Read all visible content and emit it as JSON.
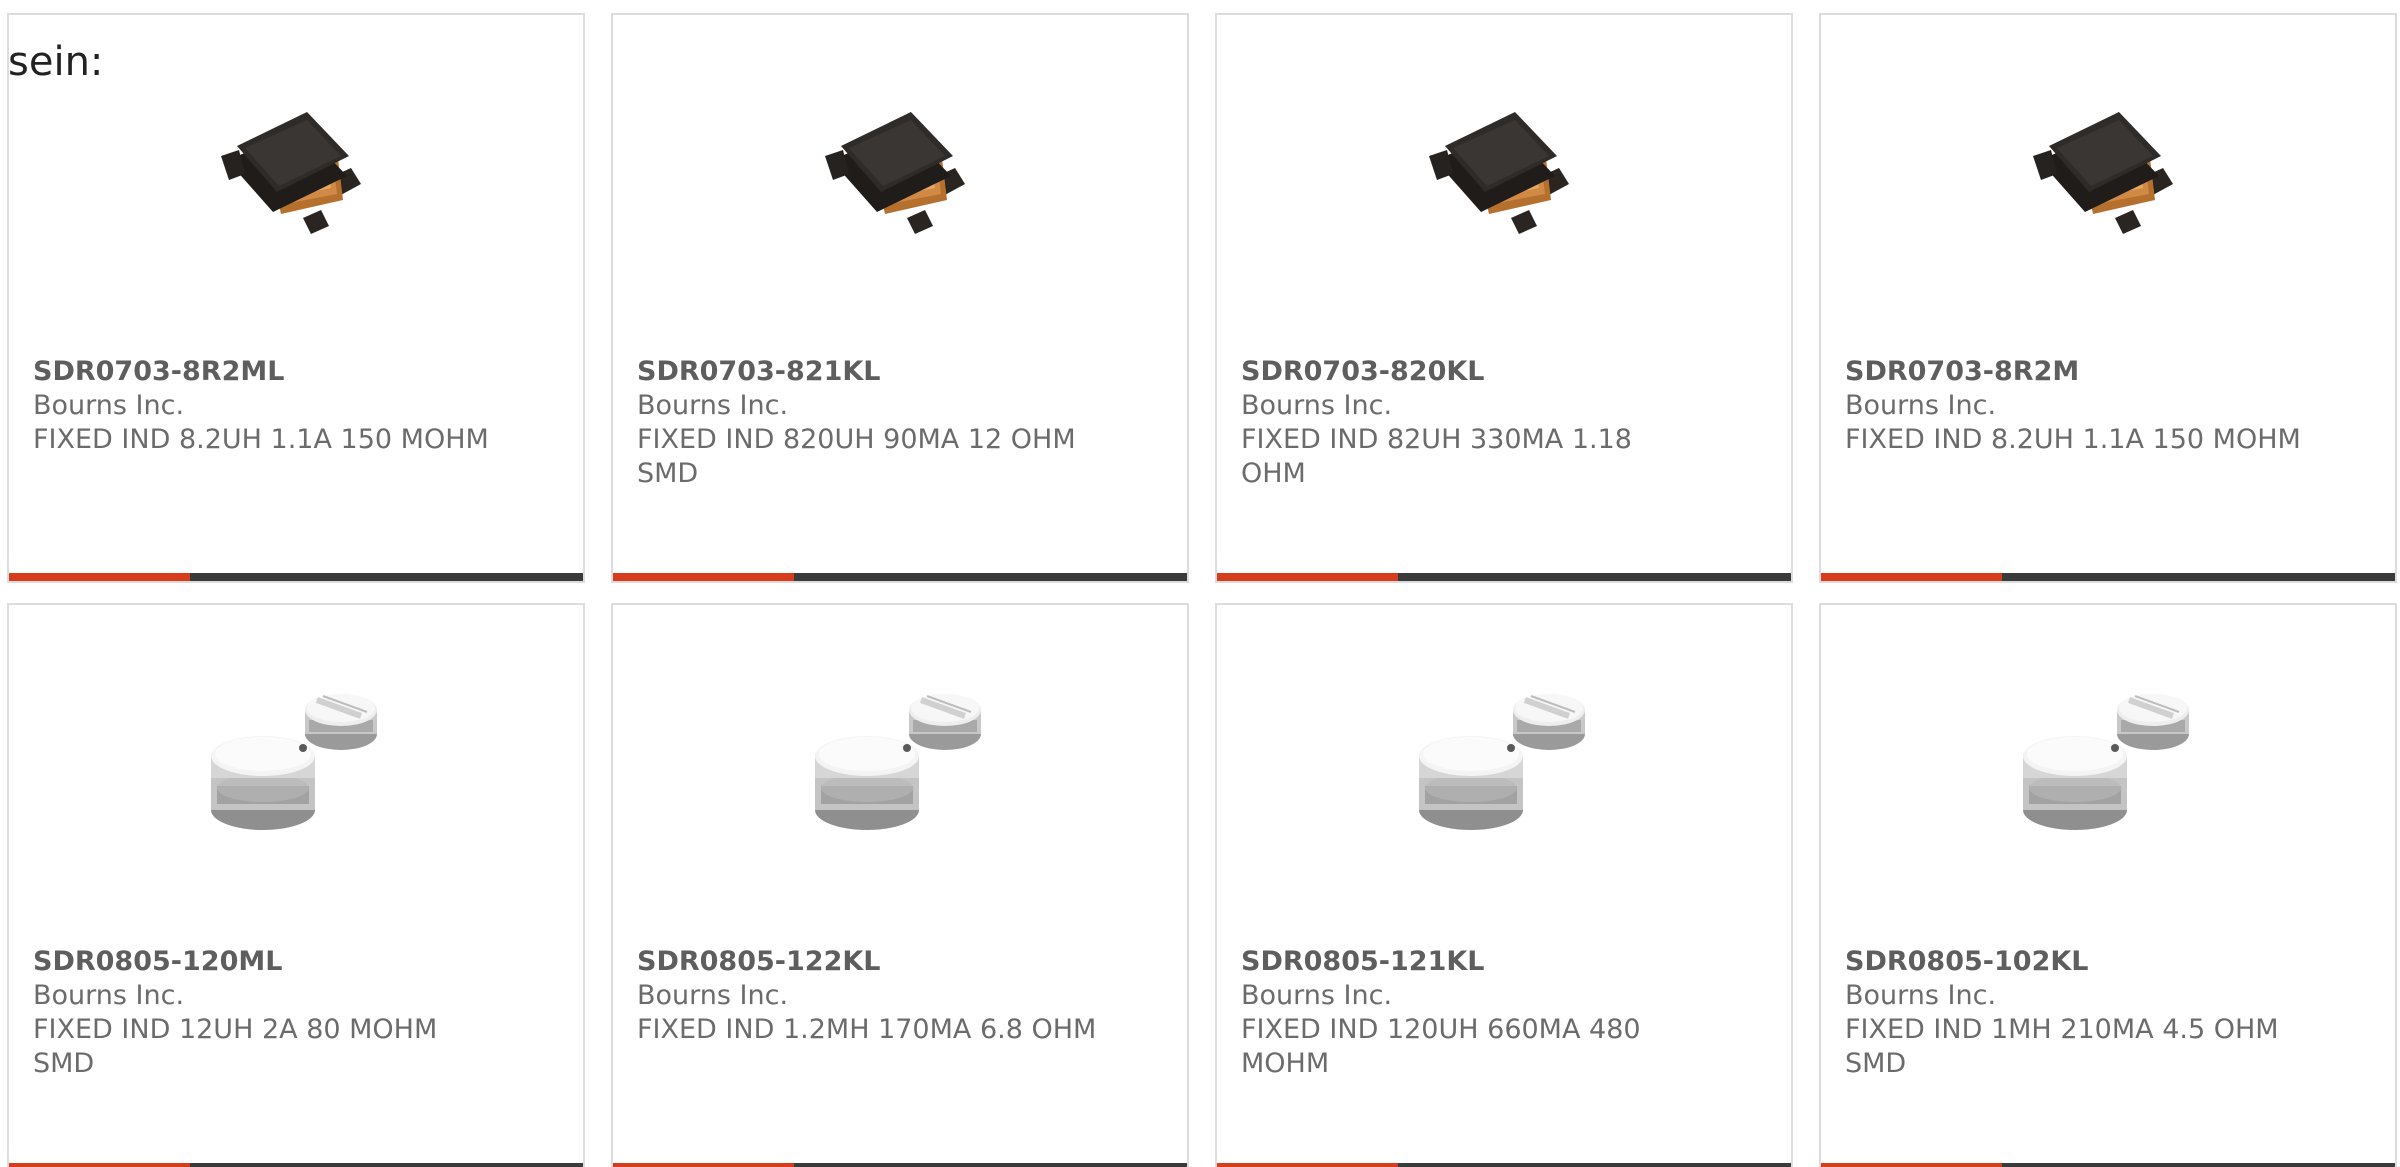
{
  "intro_text": "sein:",
  "accent_color": "#d53d1d",
  "bar_color": "#3a3a3a",
  "products": [
    {
      "part_number": "SDR0703-8R2ML",
      "manufacturer": "Bourns Inc.",
      "description": "FIXED IND 8.2UH 1.1A 150 MOHM",
      "image": "black-smd-inductor"
    },
    {
      "part_number": "SDR0703-821KL",
      "manufacturer": "Bourns Inc.",
      "description": "FIXED IND 820UH 90MA 12 OHM SMD",
      "image": "black-smd-inductor"
    },
    {
      "part_number": "SDR0703-820KL",
      "manufacturer": "Bourns Inc.",
      "description": "FIXED IND 82UH 330MA 1.18 OHM",
      "image": "black-smd-inductor"
    },
    {
      "part_number": "SDR0703-8R2M",
      "manufacturer": "Bourns Inc.",
      "description": "FIXED IND 8.2UH 1.1A 150 MOHM",
      "image": "black-smd-inductor"
    },
    {
      "part_number": "SDR0805-120ML",
      "manufacturer": "Bourns Inc.",
      "description": "FIXED IND 12UH 2A 80 MOHM SMD",
      "image": "white-drum-inductor"
    },
    {
      "part_number": "SDR0805-122KL",
      "manufacturer": "Bourns Inc.",
      "description": "FIXED IND 1.2MH 170MA 6.8 OHM",
      "image": "white-drum-inductor"
    },
    {
      "part_number": "SDR0805-121KL",
      "manufacturer": "Bourns Inc.",
      "description": "FIXED IND 120UH 660MA 480 MOHM",
      "image": "white-drum-inductor"
    },
    {
      "part_number": "SDR0805-102KL",
      "manufacturer": "Bourns Inc.",
      "description": "FIXED IND 1MH 210MA 4.5 OHM SMD",
      "image": "white-drum-inductor"
    }
  ]
}
